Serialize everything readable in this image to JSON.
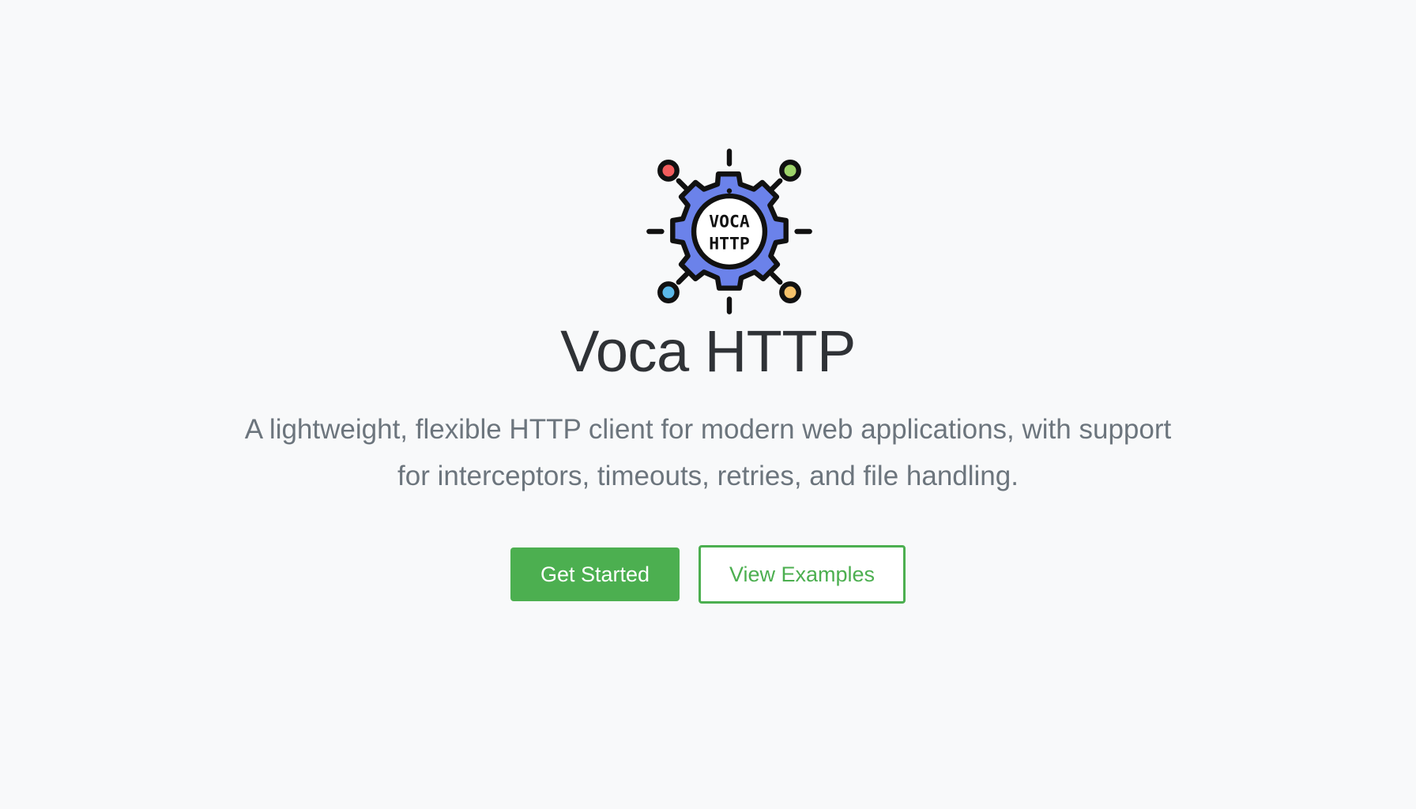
{
  "logo": {
    "icon": "gear-network-icon",
    "text_line1": "VOCA",
    "text_line2": "HTTP",
    "gear_color": "#6b82ea",
    "node_colors": [
      "#f25c5c",
      "#9ed36a",
      "#5bb8e8",
      "#f5c26b"
    ]
  },
  "title": "Voca HTTP",
  "tagline": "A lightweight, flexible HTTP client for modern web applications, with support for interceptors, timeouts, retries, and file handling.",
  "buttons": {
    "primary_label": "Get Started",
    "secondary_label": "View Examples"
  },
  "colors": {
    "background": "#f8f9fa",
    "accent": "#4caf50",
    "title": "#2f3236",
    "tagline": "#6c757d"
  }
}
